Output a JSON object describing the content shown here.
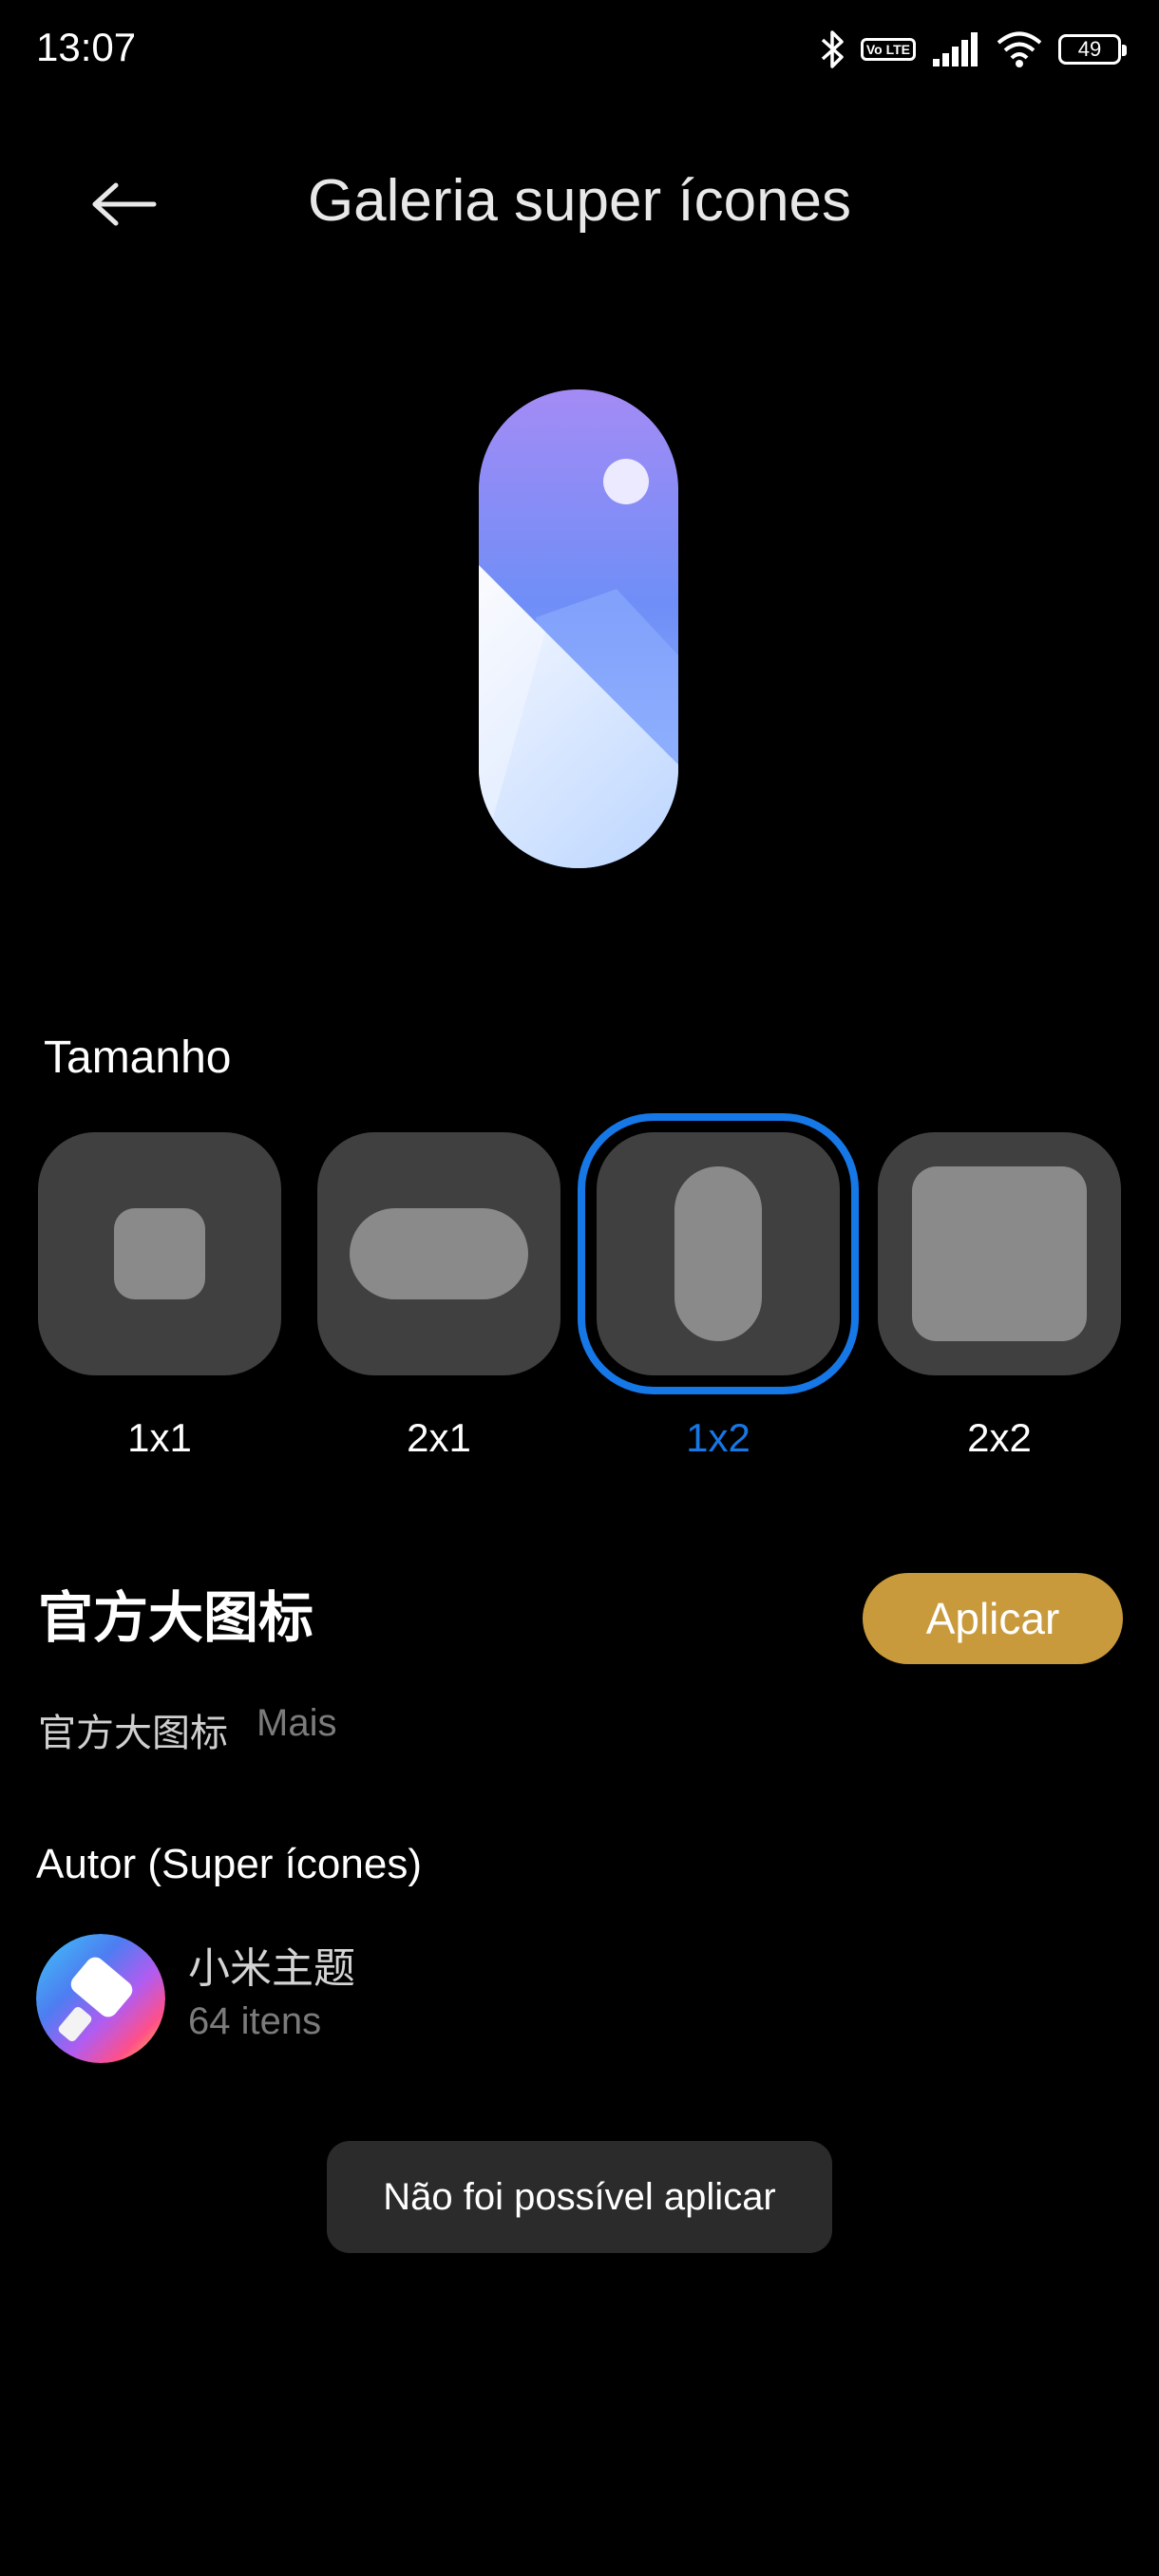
{
  "status_bar": {
    "time": "13:07",
    "volte": "Vo LTE",
    "battery": "49"
  },
  "header": {
    "title": "Galeria super ícones",
    "back_icon": "arrow-left-icon"
  },
  "size_section": {
    "label": "Tamanho",
    "options": [
      {
        "label": "1x1",
        "selected": false
      },
      {
        "label": "2x1",
        "selected": false
      },
      {
        "label": "1x2",
        "selected": true
      },
      {
        "label": "2x2",
        "selected": false
      }
    ]
  },
  "theme": {
    "title": "官方大图标",
    "apply_label": "Aplicar",
    "subtitle": "官方大图标",
    "more_label": "Mais"
  },
  "author": {
    "label": "Autor (Super ícones)",
    "name": "小米主题",
    "count": "64 itens"
  },
  "toast": {
    "message": "Não foi possível aplicar"
  },
  "colors": {
    "accent_blue": "#1677e6",
    "apply_gold": "#c89a3c",
    "tile_bg": "#404040"
  }
}
